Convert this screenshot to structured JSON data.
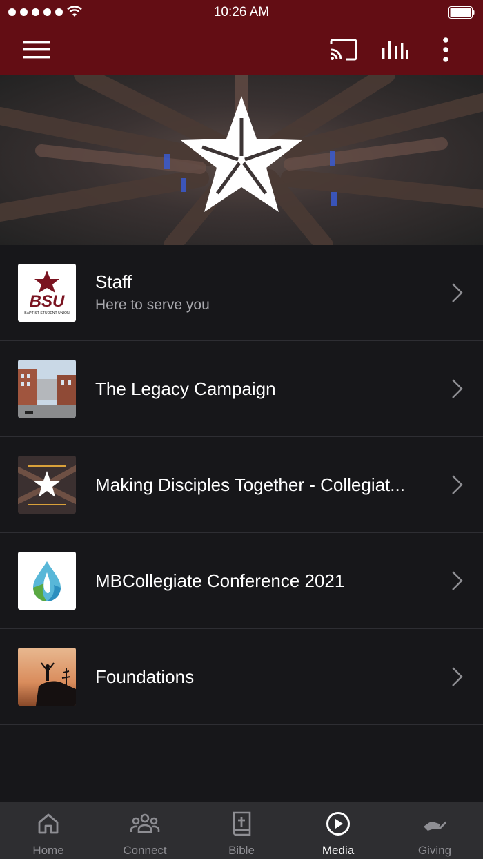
{
  "status": {
    "time": "10:26 AM"
  },
  "appbar": {
    "icons": [
      "menu-icon",
      "cast-icon",
      "equalizer-icon",
      "more-vert-icon"
    ]
  },
  "list": {
    "items": [
      {
        "title": "Staff",
        "subtitle": "Here to serve you",
        "thumb_text": "BSU",
        "thumb_subtext": "BAPTIST STUDENT UNION"
      },
      {
        "title": "The Legacy Campaign"
      },
      {
        "title": "Making Disciples Together - Collegiat..."
      },
      {
        "title": "MBCollegiate Conference 2021"
      },
      {
        "title": "Foundations"
      }
    ]
  },
  "tabs": [
    {
      "label": "Home",
      "icon": "home-icon"
    },
    {
      "label": "Connect",
      "icon": "people-icon"
    },
    {
      "label": "Bible",
      "icon": "bible-icon"
    },
    {
      "label": "Media",
      "icon": "play-circle-icon",
      "active": true
    },
    {
      "label": "Giving",
      "icon": "giving-hand-icon"
    }
  ],
  "colors": {
    "brand": "#630d14",
    "background": "#17171a",
    "tabbar": "#2e2e31"
  }
}
